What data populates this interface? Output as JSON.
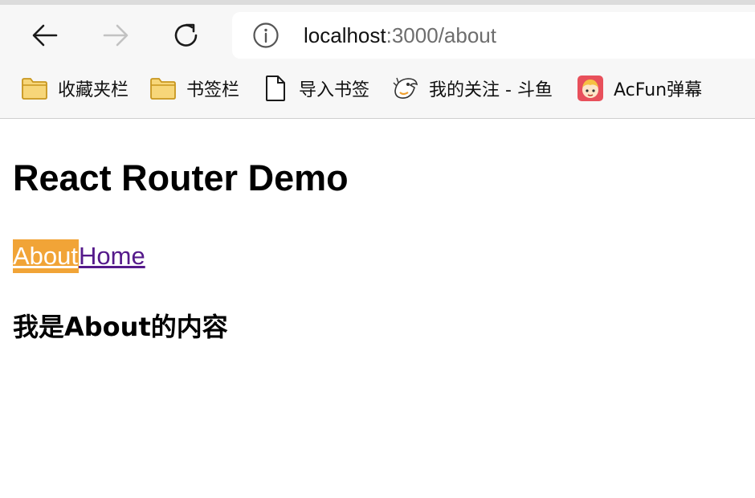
{
  "browser": {
    "address": {
      "host": "localhost",
      "rest": ":3000/about"
    },
    "bookmarks": [
      {
        "label": "收藏夹栏",
        "icon": "folder-icon"
      },
      {
        "label": "书签栏",
        "icon": "folder-icon"
      },
      {
        "label": "导入书签",
        "icon": "document-icon"
      },
      {
        "label": "我的关注 - 斗鱼",
        "icon": "douyu-icon"
      },
      {
        "label": "AcFun弹幕",
        "icon": "acfun-icon"
      }
    ],
    "colors": {
      "folder_fill": "#f7d679",
      "folder_stroke": "#c8961e"
    }
  },
  "page": {
    "title": "React Router Demo",
    "links": [
      {
        "label": "About",
        "active": true
      },
      {
        "label": "Home",
        "active": false
      }
    ],
    "content": "我是About的内容"
  },
  "colors": {
    "active_link_bg": "#f1a437",
    "visited_link": "#551a8b"
  }
}
